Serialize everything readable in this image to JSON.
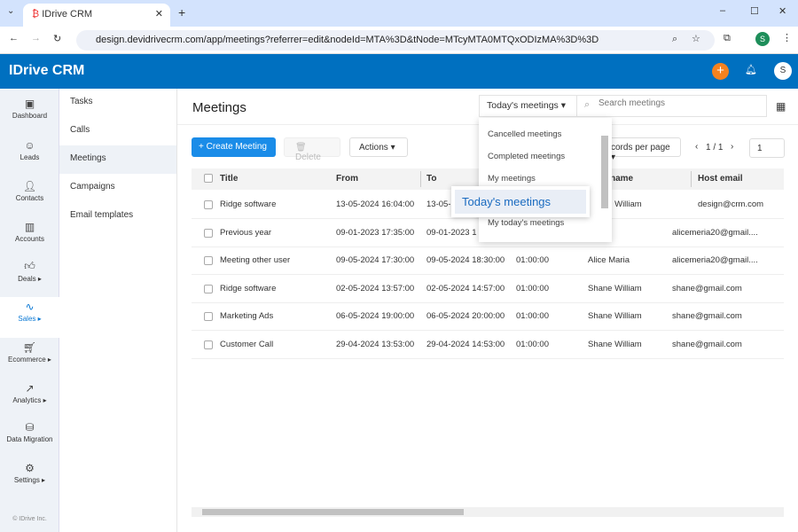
{
  "browser": {
    "tab_title": "IDrive CRM",
    "url": "design.devidrivecrm.com/app/meetings?referrer=edit&nodeId=MTA%3D&tNode=MTcyMTA0MTQxODIzMA%3D%3D",
    "profile_initial": "S"
  },
  "app": {
    "logo": "IDrive CRM",
    "user_initial": "S",
    "brand_color": "#0070c0",
    "accent_color": "#f5821f"
  },
  "rail": [
    {
      "label": "Dashboard",
      "icon": "dashboard-icon"
    },
    {
      "label": "Leads",
      "icon": "leads-icon"
    },
    {
      "label": "Contacts",
      "icon": "contacts-icon"
    },
    {
      "label": "Accounts",
      "icon": "accounts-icon"
    },
    {
      "label": "Deals ▸",
      "icon": "thumbs-up-icon"
    },
    {
      "label": "Sales ▸",
      "icon": "pulse-icon",
      "active": true
    },
    {
      "label": "Ecommerce ▸",
      "icon": "cart-icon"
    },
    {
      "label": "Analytics ▸",
      "icon": "chart-icon"
    },
    {
      "label": "Data Migration",
      "icon": "database-icon"
    },
    {
      "label": "Settings ▸",
      "icon": "gear-icon"
    }
  ],
  "copyright": "© IDrive Inc.",
  "submenu": [
    {
      "label": "Tasks"
    },
    {
      "label": "Calls"
    },
    {
      "label": "Meetings",
      "active": true
    },
    {
      "label": "Campaigns"
    },
    {
      "label": "Email templates"
    }
  ],
  "main": {
    "title": "Meetings",
    "filter_selected": "Today's meetings",
    "search_placeholder": "Search meetings",
    "create_label": "+ Create Meeting",
    "delete_label": "Delete",
    "actions_label": "Actions",
    "records_label": "cords per page",
    "pagination": "1 / 1",
    "page_input": "1"
  },
  "dropdown": {
    "options": [
      "Cancelled meetings",
      "Completed meetings",
      "My meetings",
      "Today's meetings",
      "My today's meetings"
    ],
    "highlighted": "Today's meetings"
  },
  "table": {
    "headers": [
      "Title",
      "From",
      "To",
      "",
      "Host name",
      "Host email"
    ],
    "rows": [
      [
        "Ridge software",
        "13-05-2024 16:04:00",
        "13-05-2",
        "",
        "Shane William",
        "design@crm.com"
      ],
      [
        "Previous year",
        "09-01-2023 17:35:00",
        "09-01-2023 1",
        "",
        "",
        "alicemeria20@gmail...."
      ],
      [
        "Meeting other user",
        "09-05-2024 17:30:00",
        "09-05-2024 18:30:00",
        "01:00:00",
        "Alice Maria",
        "alicemeria20@gmail...."
      ],
      [
        "Ridge software",
        "02-05-2024 13:57:00",
        "02-05-2024 14:57:00",
        "01:00:00",
        "Shane William",
        "shane@gmail.com"
      ],
      [
        "Marketing Ads",
        "06-05-2024 19:00:00",
        "06-05-2024 20:00:00",
        "01:00:00",
        "Shane William",
        "shane@gmail.com"
      ],
      [
        "Customer Call",
        "29-04-2024 13:53:00",
        "29-04-2024 14:53:00",
        "01:00:00",
        "Shane William",
        "shane@gmail.com"
      ]
    ]
  }
}
